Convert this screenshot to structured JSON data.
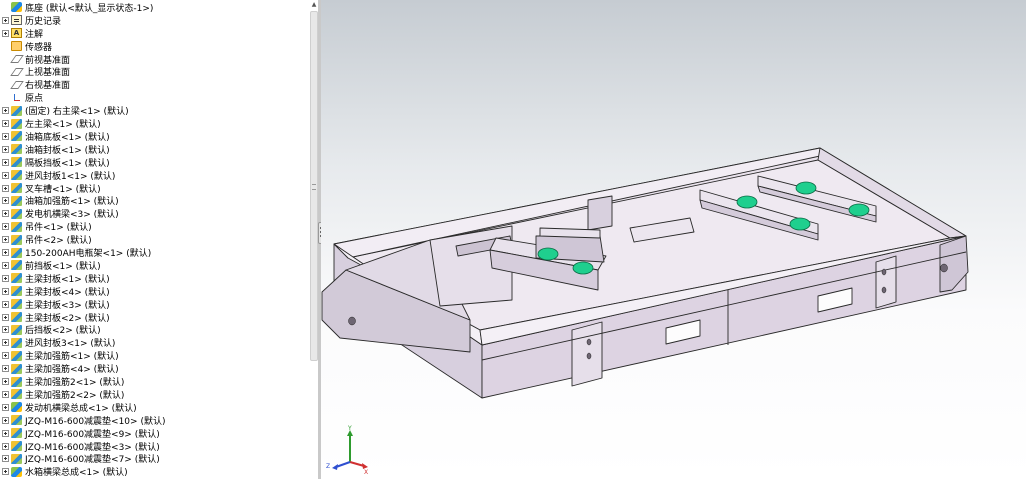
{
  "feature_tree": {
    "items": [
      {
        "label": "底座 (默认<默认_显示状态-1>)",
        "icon": "assembly-icon",
        "expander": false
      },
      {
        "label": "历史记录",
        "icon": "history-icon",
        "expander": true
      },
      {
        "label": "注解",
        "icon": "annotation-icon",
        "expander": true
      },
      {
        "label": "传感器",
        "icon": "sensor-icon",
        "expander": false
      },
      {
        "label": "前视基准面",
        "icon": "plane-icon",
        "expander": false
      },
      {
        "label": "上视基准面",
        "icon": "plane-icon",
        "expander": false
      },
      {
        "label": "右视基准面",
        "icon": "plane-icon",
        "expander": false
      },
      {
        "label": "原点",
        "icon": "origin-icon",
        "expander": false
      },
      {
        "label": "(固定) 右主梁<1> (默认)",
        "icon": "part-icon",
        "expander": true
      },
      {
        "label": "左主梁<1> (默认)",
        "icon": "part-icon",
        "expander": true
      },
      {
        "label": "油箱底板<1> (默认)",
        "icon": "part-icon",
        "expander": true
      },
      {
        "label": "油箱封板<1> (默认)",
        "icon": "part-icon",
        "expander": true
      },
      {
        "label": "隔板挡板<1> (默认)",
        "icon": "part-icon",
        "expander": true
      },
      {
        "label": "进风封板1<1> (默认)",
        "icon": "part-icon",
        "expander": true
      },
      {
        "label": "叉车槽<1> (默认)",
        "icon": "part-icon",
        "expander": true
      },
      {
        "label": "油箱加强筋<1> (默认)",
        "icon": "part-icon",
        "expander": true
      },
      {
        "label": "发电机横梁<3> (默认)",
        "icon": "part-icon",
        "expander": true
      },
      {
        "label": "吊件<1> (默认)",
        "icon": "part-icon",
        "expander": true
      },
      {
        "label": "吊件<2> (默认)",
        "icon": "part-icon",
        "expander": true
      },
      {
        "label": "150-200AH电瓶架<1> (默认)",
        "icon": "part-icon",
        "expander": true
      },
      {
        "label": "前挡板<1> (默认)",
        "icon": "part-icon",
        "expander": true
      },
      {
        "label": "主梁封板<1> (默认)",
        "icon": "part-icon",
        "expander": true
      },
      {
        "label": "主梁封板<4> (默认)",
        "icon": "part-icon",
        "expander": true
      },
      {
        "label": "主梁封板<3> (默认)",
        "icon": "part-icon",
        "expander": true
      },
      {
        "label": "主梁封板<2> (默认)",
        "icon": "part-icon",
        "expander": true
      },
      {
        "label": "后挡板<2> (默认)",
        "icon": "part-icon",
        "expander": true
      },
      {
        "label": "进风封板3<1> (默认)",
        "icon": "part-icon",
        "expander": true
      },
      {
        "label": "主梁加强筋<1> (默认)",
        "icon": "part-icon",
        "expander": true
      },
      {
        "label": "主梁加强筋<4> (默认)",
        "icon": "part-icon",
        "expander": true
      },
      {
        "label": "主梁加强筋2<1> (默认)",
        "icon": "part-icon",
        "expander": true
      },
      {
        "label": "主梁加强筋2<2> (默认)",
        "icon": "part-icon",
        "expander": true
      },
      {
        "label": "发动机横梁总成<1> (默认)",
        "icon": "assembly-icon",
        "expander": true
      },
      {
        "label": "JZQ-M16-600减震垫<10> (默认)",
        "icon": "part-icon",
        "expander": true
      },
      {
        "label": "JZQ-M16-600减震垫<9> (默认)",
        "icon": "part-icon",
        "expander": true
      },
      {
        "label": "JZQ-M16-600减震垫<3> (默认)",
        "icon": "part-icon",
        "expander": true
      },
      {
        "label": "JZQ-M16-600减震垫<7> (默认)",
        "icon": "part-icon",
        "expander": true
      },
      {
        "label": "水箱横梁总成<1> (默认)",
        "icon": "assembly-icon",
        "expander": true
      }
    ]
  },
  "viewport": {
    "model_colors": {
      "frame": "#ddd3e2",
      "frame_dark": "#b8aebf",
      "edge": "#2a2a2a",
      "damper": "#1fcf8e"
    },
    "triad": {
      "x_label": "X",
      "y_label": "Y",
      "z_label": "Z"
    }
  },
  "colors": {
    "viewport_top": "#c6ccd2",
    "viewport_bottom": "#ffffff",
    "splitter": "#c9c9c9"
  }
}
